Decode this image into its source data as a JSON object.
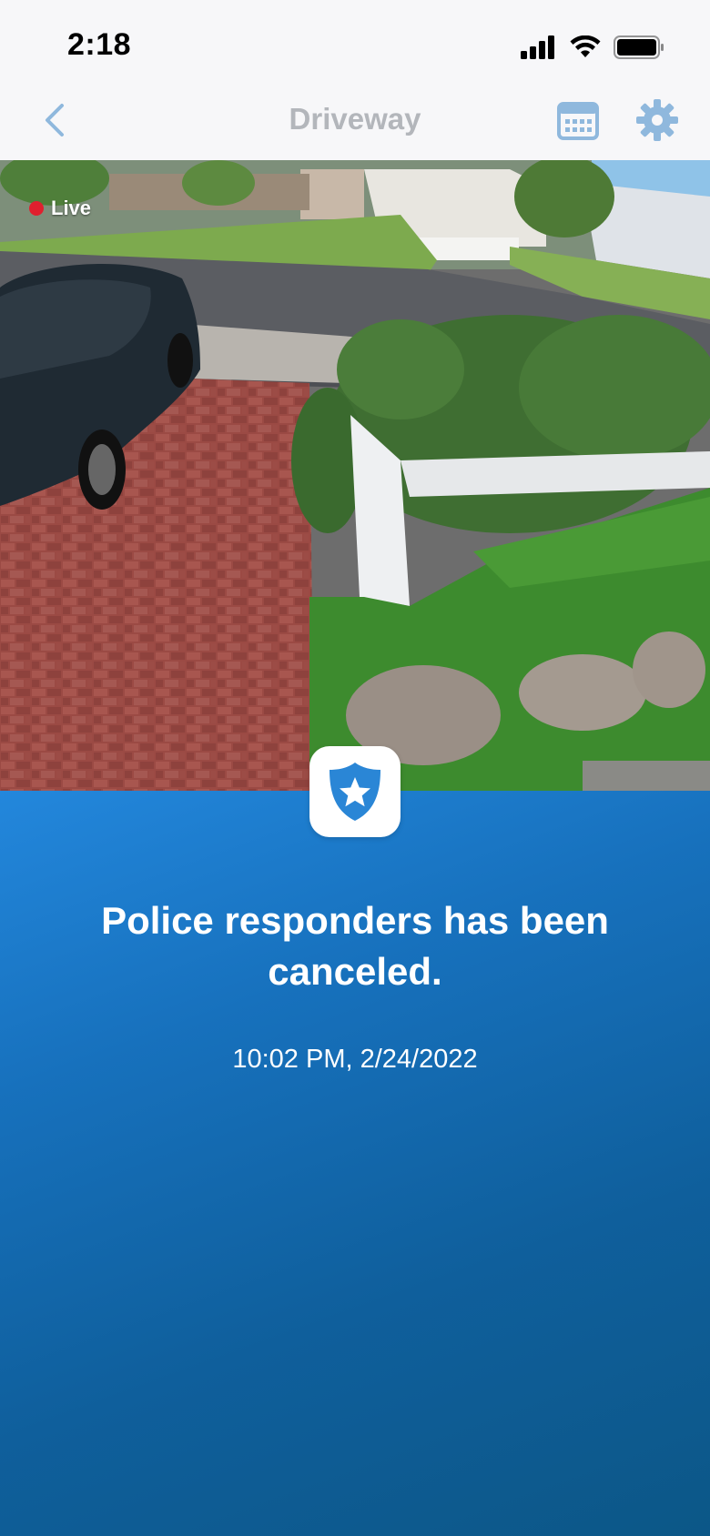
{
  "status_bar": {
    "time": "2:18",
    "icons": [
      "signal-icon",
      "wifi-icon",
      "battery-icon"
    ]
  },
  "nav": {
    "title": "Driveway",
    "back_icon": "chevron-left-icon",
    "calendar_icon": "calendar-icon",
    "settings_icon": "gear-icon"
  },
  "camera": {
    "live_label": "Live",
    "live_color": "#e0202e"
  },
  "alert": {
    "icon": "police-badge-icon",
    "message": "Police responders has been canceled.",
    "timestamp": "10:02 PM, 2/24/2022"
  },
  "colors": {
    "accent": "#2387dc",
    "panel_dark": "#0c5787",
    "nav_inactive": "#b3b6bb",
    "icon_tint": "#8fb8dd"
  }
}
